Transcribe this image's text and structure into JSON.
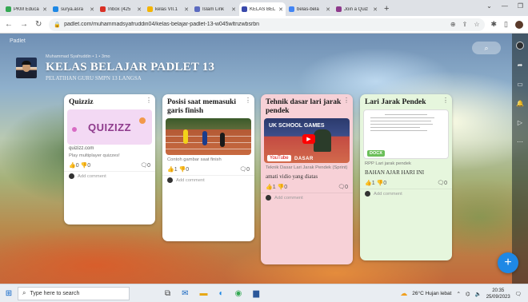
{
  "browser": {
    "tabs": [
      {
        "label": "PKM Educa",
        "color": "#34a853"
      },
      {
        "label": "surya.asra",
        "color": "#1e88e5"
      },
      {
        "label": "Inbox (425",
        "color": "#d93025"
      },
      {
        "label": "kelas VII.1",
        "color": "#f4b400"
      },
      {
        "label": "Islam Link",
        "color": "#5c6bc0"
      },
      {
        "label": "KELAS BEL",
        "color": "#3949ab",
        "active": true
      },
      {
        "label": "belas-bela",
        "color": "#4285f4"
      },
      {
        "label": "Join a Quiz",
        "color": "#8e3a8c"
      }
    ],
    "new_tab": "+",
    "url": "padlet.com/muhammadsyafruddin04/kelas-belajar-padlet-13-w045wltnzwbsrbn"
  },
  "padlet": {
    "label": "Padlet",
    "author": "Muhammad Syafruddin • 1 • 3mo",
    "title": "KELAS BELAJAR PADLET 13",
    "subtitle": "PELATIHAN GURU SMPN 13 LANGSA",
    "fab": "+"
  },
  "cards": [
    {
      "title": "Quizziz",
      "image_text": "QUIZIZZ",
      "domain": "quizizz.com",
      "desc": "Play multiplayer quizzes!",
      "body": "",
      "likes": "0",
      "dislikes": "0",
      "comments": "0",
      "add_comment": "Add comment"
    },
    {
      "title": "Posisi saat memasuki garis finish",
      "desc": "Contoh gambar saat finish",
      "body": "",
      "likes": "1",
      "dislikes": "0",
      "comments": "0",
      "add_comment": "Add comment"
    },
    {
      "title": "Tehnik dasar lari jarak pendek",
      "image_text": "UK SCHOOL GAMES",
      "tag": "YouTube",
      "tag2": "DASAR",
      "desc": "Teknik Dasar Lari Jarak Pendek (Sprint)",
      "body": "amati vidio yang diatas",
      "likes": "1",
      "dislikes": "0",
      "comments": "0",
      "add_comment": "Add comment"
    },
    {
      "title": "Lari Jarak Pendek",
      "tag": "DOCX",
      "desc": "RPP Lari jarak pendek",
      "body": "BAHAN AJAR HARI INI",
      "likes": "1",
      "dislikes": "0",
      "comments": "0",
      "add_comment": "Add comment"
    }
  ],
  "taskbar": {
    "search_placeholder": "Type here to search",
    "weather": "26°C  Hujan lebat",
    "time": "20:35",
    "date": "25/09/2023"
  },
  "colors": {
    "fab": "#1e88e5",
    "card_pink": "#f7d1d7",
    "card_green": "#e6f6dd"
  }
}
